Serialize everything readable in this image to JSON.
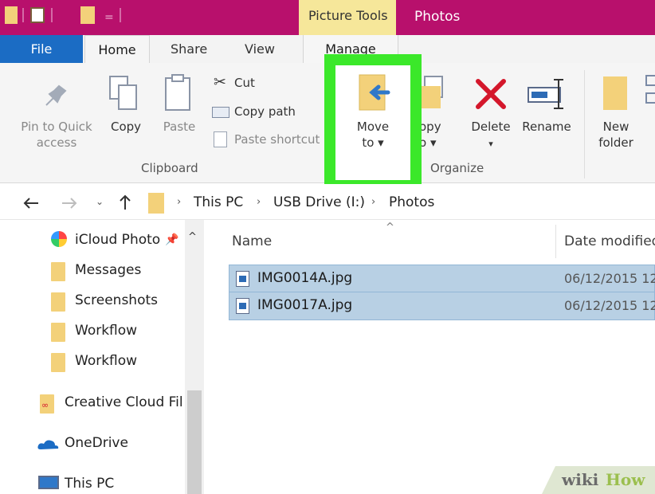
{
  "titlebar": {
    "contextual_tab": "Picture Tools",
    "window_title": "Photos",
    "accent_color": "#b8106c"
  },
  "tabs": {
    "file": "File",
    "home": "Home",
    "share": "Share",
    "view": "View",
    "manage": "Manage"
  },
  "ribbon": {
    "pin_to_quick_access": [
      "Pin to Quick",
      "access"
    ],
    "copy": "Copy",
    "paste": "Paste",
    "cut": "Cut",
    "copy_path": "Copy path",
    "paste_shortcut": "Paste shortcut",
    "clipboard_group": "Clipboard",
    "move_to": [
      "Move",
      "to ▾"
    ],
    "copy_to": [
      "opy",
      "o ▾"
    ],
    "delete": "Delete",
    "rename": "Rename",
    "new_folder": [
      "New",
      "folder"
    ],
    "organize_group": "Organize",
    "highlight_color": "#3be82a"
  },
  "address": {
    "crumbs": [
      "This PC",
      "USB Drive (I:)",
      "Photos"
    ]
  },
  "nav": {
    "items": [
      "iCloud Photo",
      "Messages",
      "Screenshots",
      "Workflow",
      "Workflow",
      "Creative Cloud Fil",
      "OneDrive",
      "This PC"
    ]
  },
  "list": {
    "columns": {
      "name": "Name",
      "date": "Date modified"
    },
    "rows": [
      {
        "name": "IMG0014A.jpg",
        "date": "06/12/2015 12"
      },
      {
        "name": "IMG0017A.jpg",
        "date": "06/12/2015 12"
      }
    ]
  },
  "watermark": {
    "wiki": "wiki",
    "how": "How"
  }
}
